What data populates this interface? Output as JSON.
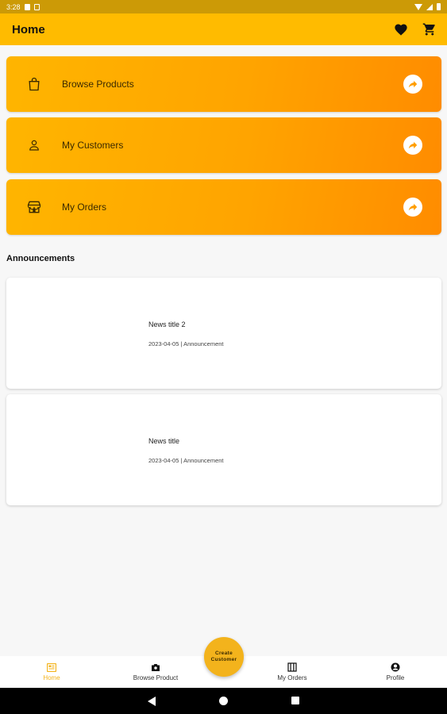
{
  "status_bar": {
    "time": "3:28"
  },
  "app_bar": {
    "title": "Home",
    "icons": [
      "heart-icon",
      "cart-icon"
    ]
  },
  "menu": [
    {
      "label": "Browse Products",
      "icon": "shopping-bag-icon"
    },
    {
      "label": "My Customers",
      "icon": "person-icon"
    },
    {
      "label": "My Orders",
      "icon": "store-icon"
    }
  ],
  "announcements": {
    "title": "Announcements",
    "items": [
      {
        "title": "News title 2",
        "meta": "2023-04-05 | Announcement"
      },
      {
        "title": "News title",
        "meta": "2023-04-05 | Announcement"
      }
    ]
  },
  "fab": {
    "label": "Create Customer"
  },
  "bottom_nav": [
    {
      "label": "Home",
      "icon": "home-icon",
      "active": true
    },
    {
      "label": "Browse Product",
      "icon": "camera-icon",
      "active": false
    },
    {
      "label": "My Orders",
      "icon": "orders-icon",
      "active": false
    },
    {
      "label": "Profile",
      "icon": "profile-icon",
      "active": false
    }
  ],
  "colors": {
    "accent": "#ffbb00",
    "status_bar": "#cc9a06",
    "active_nav": "#f3b31c",
    "card_gradient_end": "#ff8c00"
  }
}
